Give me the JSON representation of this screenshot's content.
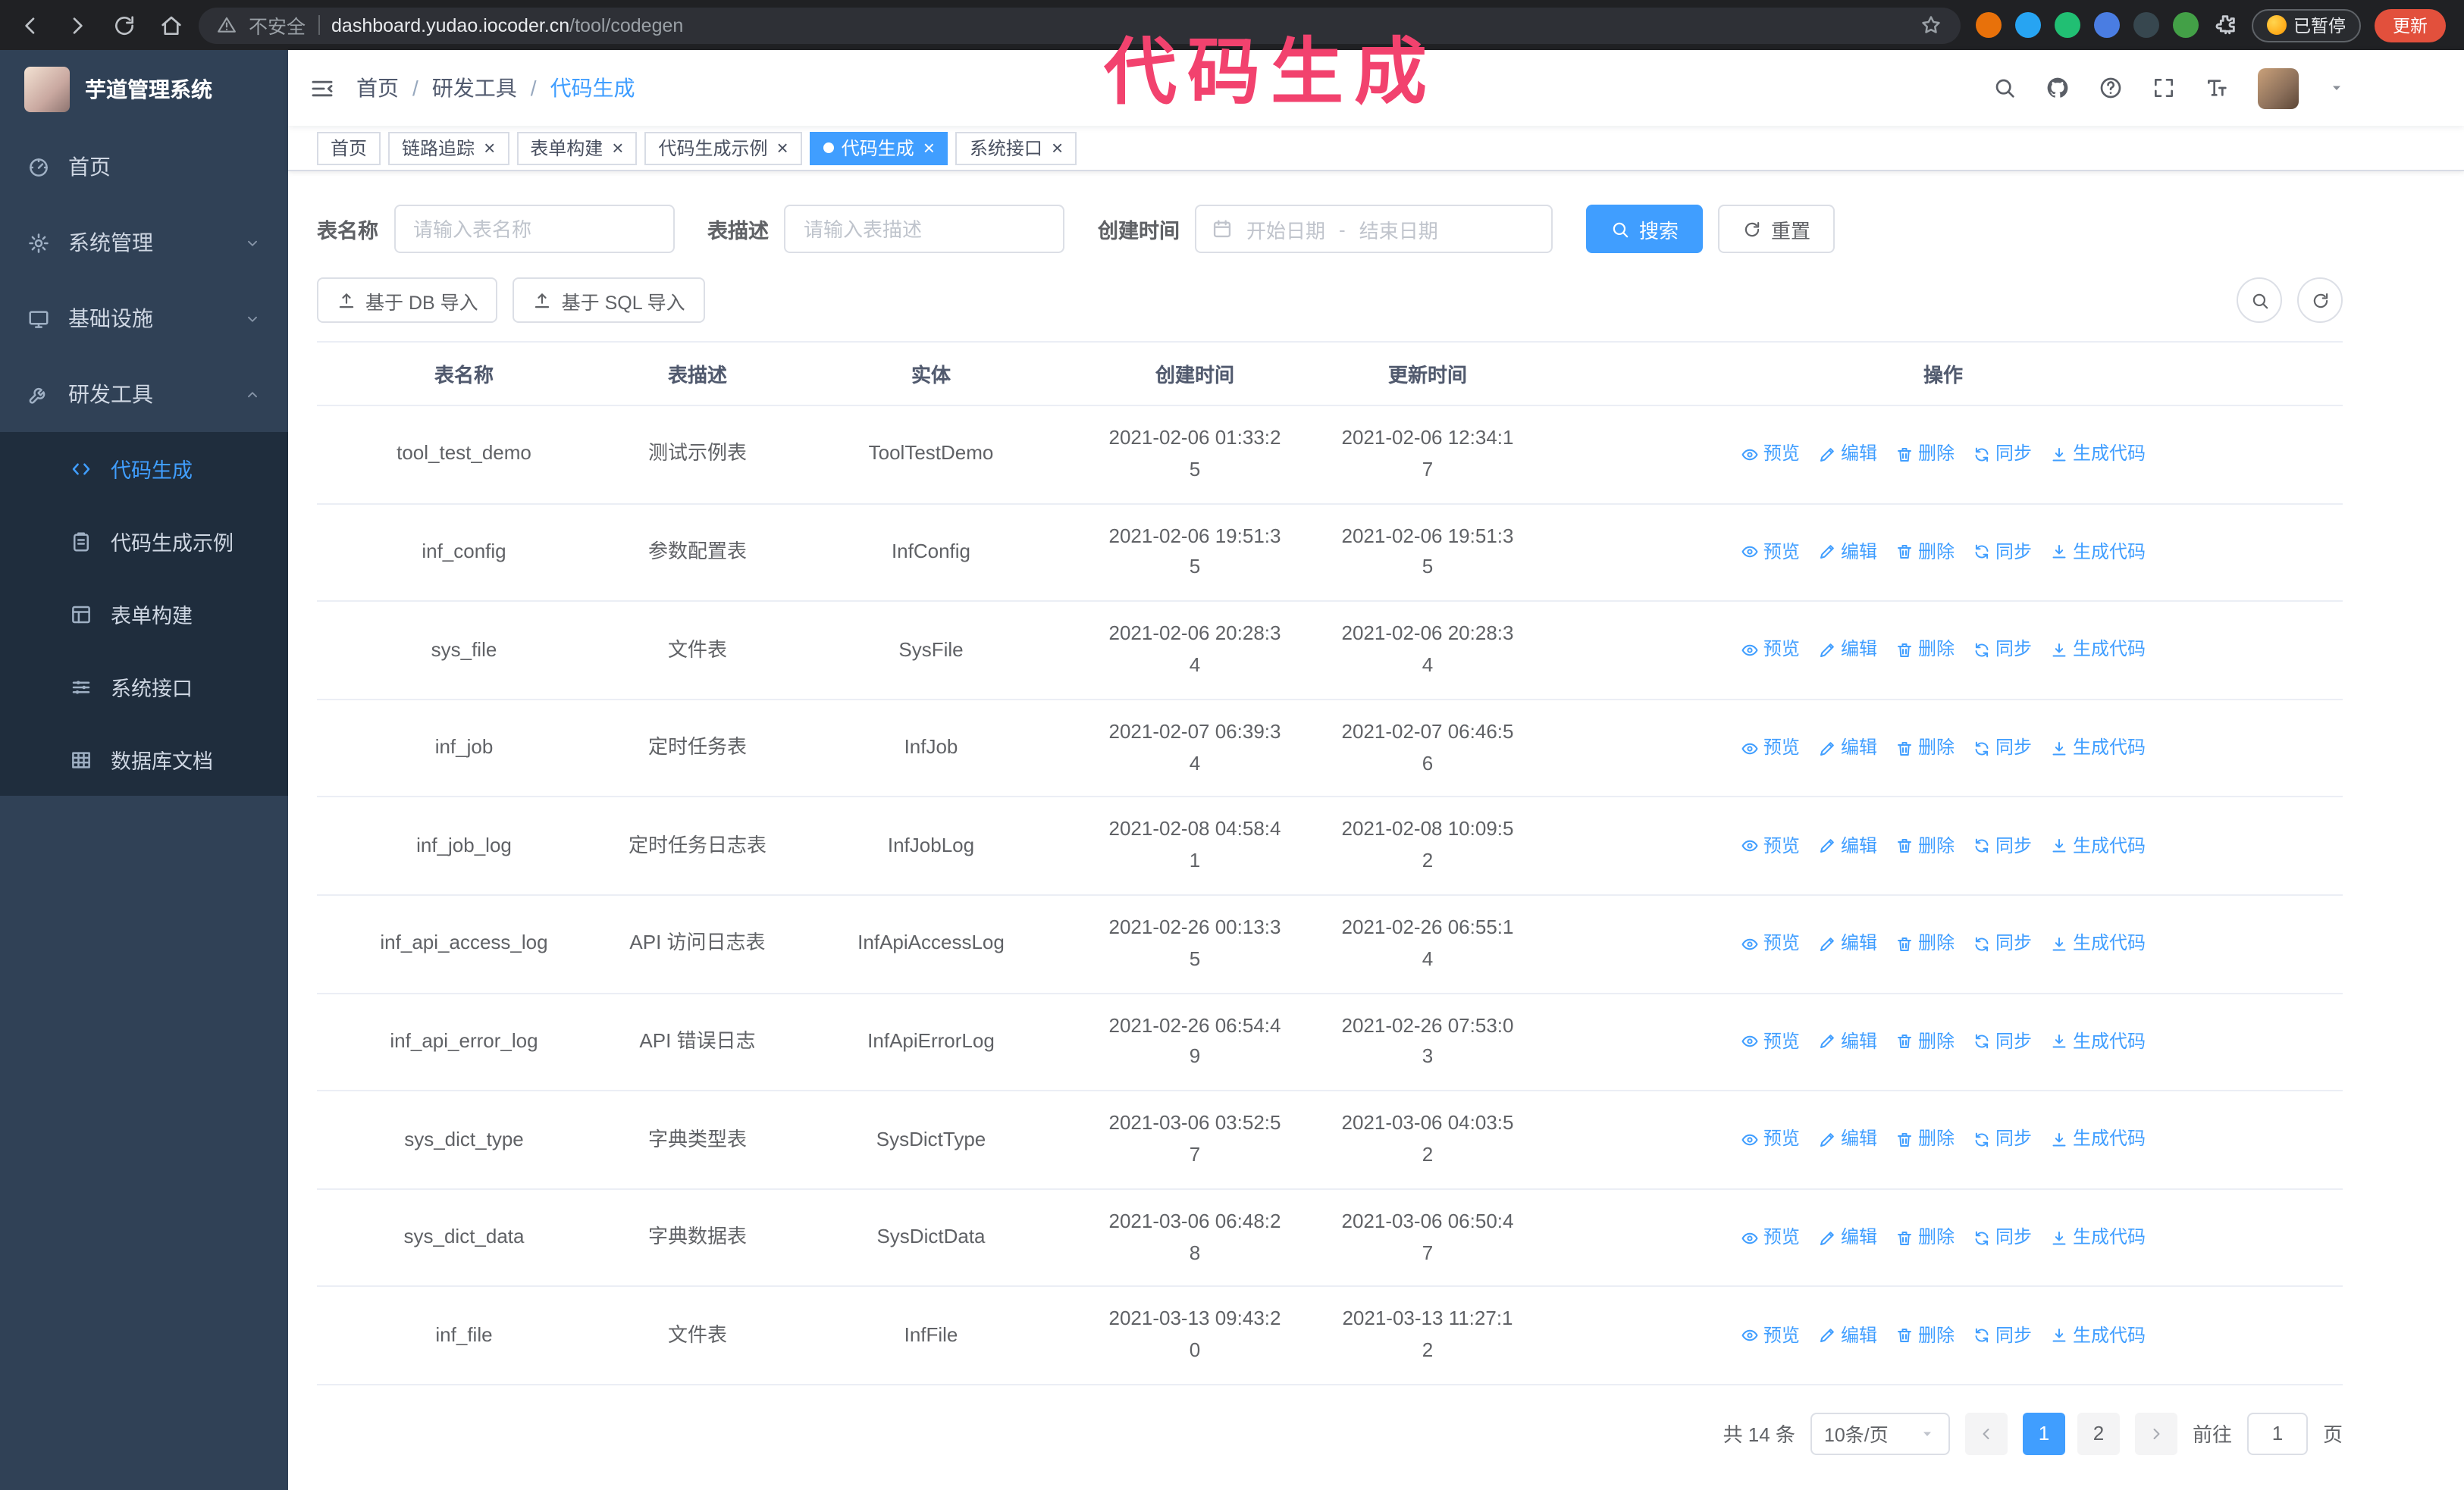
{
  "browser": {
    "security_warning": "不安全",
    "url_host": "dashboard.yudao.iocoder.cn",
    "url_path": "/tool/codegen",
    "paused_badge": "已暂停",
    "update_button": "更新",
    "extensions": [
      {
        "name": "fox-extension-icon",
        "color": "#e8710a"
      },
      {
        "name": "drop-extension-icon",
        "color": "#27a4f2"
      },
      {
        "name": "check-extension-icon",
        "color": "#21bf73"
      },
      {
        "name": "users-extension-icon",
        "color": "#4a7de2"
      },
      {
        "name": "camera-extension-icon",
        "color": "#37474f"
      },
      {
        "name": "leaf-extension-icon",
        "color": "#43a047"
      },
      {
        "name": "puzzle-extension-icon",
        "color": "#c7cbd1"
      }
    ]
  },
  "annotation": "代码生成",
  "app": {
    "title": "芋道管理系统"
  },
  "sidebar": {
    "items": [
      {
        "label": "首页",
        "icon": "dashboard-icon"
      },
      {
        "label": "系统管理",
        "icon": "gear-icon",
        "expandable": true
      },
      {
        "label": "基础设施",
        "icon": "monitor-icon",
        "expandable": true
      },
      {
        "label": "研发工具",
        "icon": "tool-icon",
        "expanded": true,
        "children": [
          {
            "label": "代码生成",
            "icon": "code-icon",
            "active": true
          },
          {
            "label": "代码生成示例",
            "icon": "clipboard-icon"
          },
          {
            "label": "表单构建",
            "icon": "form-icon"
          },
          {
            "label": "系统接口",
            "icon": "sliders-icon"
          },
          {
            "label": "数据库文档",
            "icon": "grid-icon"
          }
        ]
      }
    ]
  },
  "breadcrumb": [
    "首页",
    "研发工具",
    "代码生成"
  ],
  "breadcrumb_separator": "/",
  "tags": [
    {
      "label": "首页",
      "closable": false,
      "active": false
    },
    {
      "label": "链路追踪",
      "closable": true,
      "active": false
    },
    {
      "label": "表单构建",
      "closable": true,
      "active": false
    },
    {
      "label": "代码生成示例",
      "closable": true,
      "active": false
    },
    {
      "label": "代码生成",
      "closable": true,
      "active": true
    },
    {
      "label": "系统接口",
      "closable": true,
      "active": false
    }
  ],
  "filters": {
    "table_name_label": "表名称",
    "table_name_placeholder": "请输入表名称",
    "table_desc_label": "表描述",
    "table_desc_placeholder": "请输入表描述",
    "create_time_label": "创建时间",
    "date_start_placeholder": "开始日期",
    "date_separator": "-",
    "date_end_placeholder": "结束日期",
    "search_button": "搜索",
    "reset_button": "重置"
  },
  "toolbar": {
    "import_db": "基于 DB 导入",
    "import_sql": "基于 SQL 导入"
  },
  "table": {
    "columns": [
      "表名称",
      "表描述",
      "实体",
      "创建时间",
      "更新时间",
      "操作"
    ],
    "rows": [
      {
        "name": "tool_test_demo",
        "desc": "测试示例表",
        "entity": "ToolTestDemo",
        "created": "2021-02-06 01:33:25",
        "updated": "2021-02-06 12:34:17"
      },
      {
        "name": "inf_config",
        "desc": "参数配置表",
        "entity": "InfConfig",
        "created": "2021-02-06 19:51:35",
        "updated": "2021-02-06 19:51:35"
      },
      {
        "name": "sys_file",
        "desc": "文件表",
        "entity": "SysFile",
        "created": "2021-02-06 20:28:34",
        "updated": "2021-02-06 20:28:34"
      },
      {
        "name": "inf_job",
        "desc": "定时任务表",
        "entity": "InfJob",
        "created": "2021-02-07 06:39:34",
        "updated": "2021-02-07 06:46:56"
      },
      {
        "name": "inf_job_log",
        "desc": "定时任务日志表",
        "entity": "InfJobLog",
        "created": "2021-02-08 04:58:41",
        "updated": "2021-02-08 10:09:52"
      },
      {
        "name": "inf_api_access_log",
        "desc": "API 访问日志表",
        "entity": "InfApiAccessLog",
        "created": "2021-02-26 00:13:35",
        "updated": "2021-02-26 06:55:14"
      },
      {
        "name": "inf_api_error_log",
        "desc": "API 错误日志",
        "entity": "InfApiErrorLog",
        "created": "2021-02-26 06:54:49",
        "updated": "2021-02-26 07:53:03"
      },
      {
        "name": "sys_dict_type",
        "desc": "字典类型表",
        "entity": "SysDictType",
        "created": "2021-03-06 03:52:57",
        "updated": "2021-03-06 04:03:52"
      },
      {
        "name": "sys_dict_data",
        "desc": "字典数据表",
        "entity": "SysDictData",
        "created": "2021-03-06 06:48:28",
        "updated": "2021-03-06 06:50:47"
      },
      {
        "name": "inf_file",
        "desc": "文件表",
        "entity": "InfFile",
        "created": "2021-03-13 09:43:20",
        "updated": "2021-03-13 11:27:12"
      }
    ],
    "row_actions": [
      {
        "label": "预览",
        "icon": "eye-icon"
      },
      {
        "label": "编辑",
        "icon": "edit-icon"
      },
      {
        "label": "删除",
        "icon": "delete-icon"
      },
      {
        "label": "同步",
        "icon": "sync-icon"
      },
      {
        "label": "生成代码",
        "icon": "download-icon"
      }
    ]
  },
  "pagination": {
    "total_text": "共 14 条",
    "page_size": "10条/页",
    "pages": [
      "1",
      "2"
    ],
    "active_page": "1",
    "goto_label": "前往",
    "goto_value": "1",
    "goto_suffix": "页"
  },
  "colors": {
    "primary": "#409eff",
    "annotation": "#f2426e",
    "sidebar_bg": "#304156",
    "submenu_bg": "#1f2d3d",
    "update_button": "#e2503c"
  }
}
